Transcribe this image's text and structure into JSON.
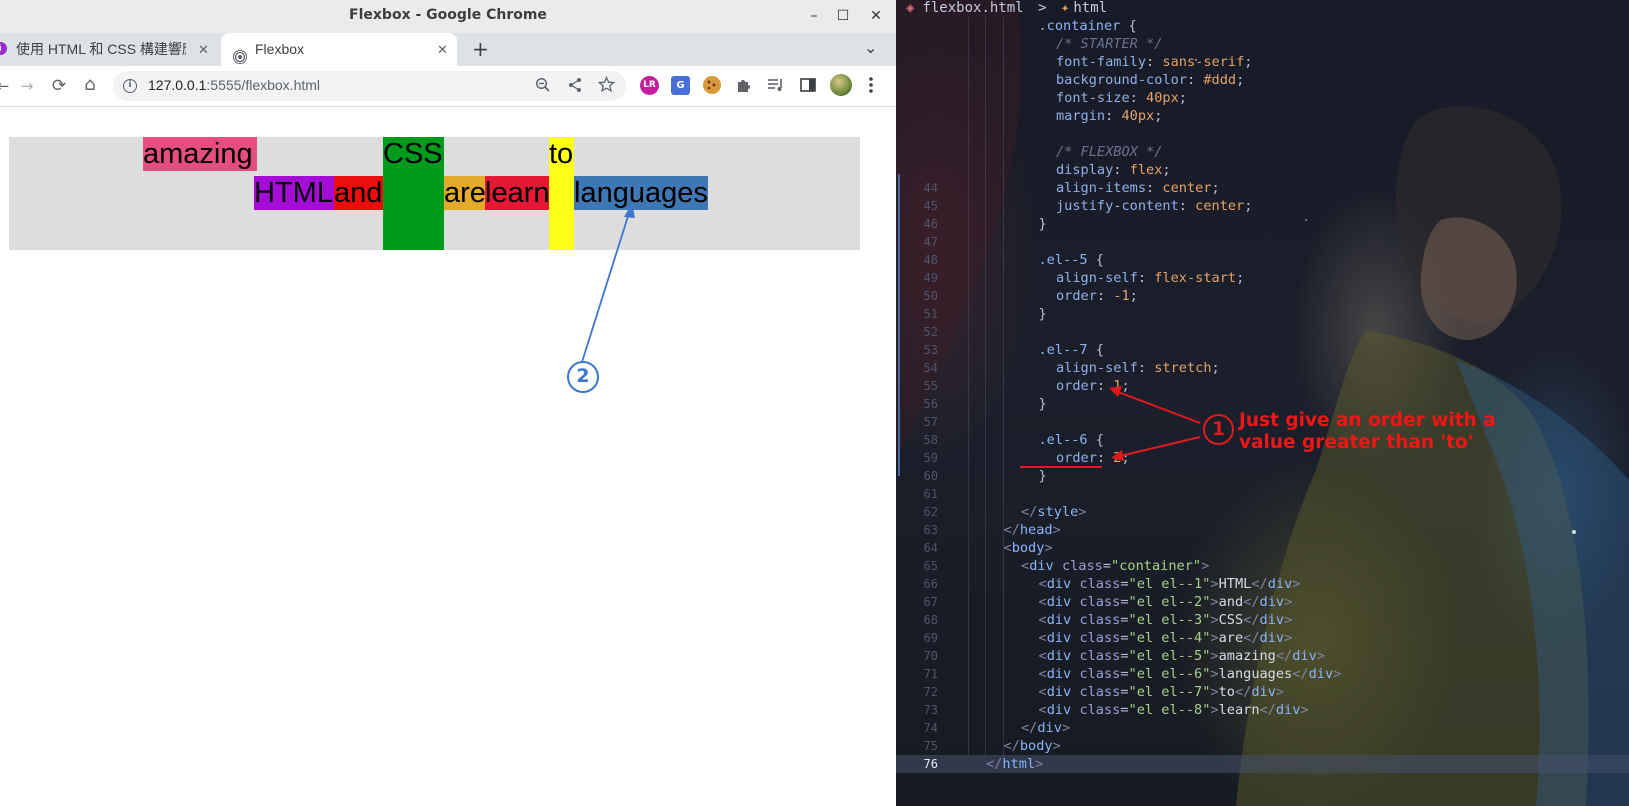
{
  "window": {
    "title": "Flexbox - Google Chrome",
    "controls": {
      "minimize": "–",
      "maximize": "☐",
      "close": "✕"
    }
  },
  "tabs": [
    {
      "label": "使用 HTML 和 CSS 構建響應式網站…",
      "favicon": "purple-circle-icon",
      "close": "✕",
      "active": false
    },
    {
      "label": "Flexbox",
      "favicon": "broadcast-icon",
      "close": "✕",
      "active": true
    }
  ],
  "tabstrip": {
    "new_tab": "+",
    "tab_search": "⌄"
  },
  "toolbar": {
    "url_host": "127.0.0.1",
    "url_rest": ":5555/flexbox.html",
    "back": "←",
    "forward": "→",
    "reload": "⟳",
    "home": "⌂"
  },
  "flex_items": {
    "amazing": "amazing",
    "css": "CSS",
    "to": "to",
    "html": "HTML",
    "and": "and",
    "are": "are",
    "learn": "learn",
    "languages": "languages"
  },
  "colors": {
    "amazing": "#e54e7f",
    "css": "#009a1d",
    "to": "#ffff1a",
    "html": "#a30dd6",
    "and": "#ec0d0d",
    "are": "#e3ab2b",
    "learn": "#e41734",
    "languages": "#3f77b5",
    "annotation_red": "#e01a1a",
    "annotation_blue": "#3a78d0"
  },
  "annotations": {
    "marker_1": "1",
    "marker_2": "2",
    "note_line1": "Just give an order with a",
    "note_line2": "value greater than 'to'"
  },
  "editor": {
    "breadcrumb_file": "flexbox.html",
    "breadcrumb_sep": ">",
    "breadcrumb_node": "html",
    "lines": [
      {
        "n": "",
        "segs": [
          [
            "t-sel",
            ".container "
          ],
          [
            "t-pun",
            "{"
          ]
        ]
      },
      {
        "n": "",
        "segs": [
          [
            "t-cmt",
            "/* STARTER */"
          ]
        ]
      },
      {
        "n": "",
        "segs": [
          [
            "t-prop",
            "font-family"
          ],
          [
            "t-pun",
            ": "
          ],
          [
            "t-val",
            "sans-serif"
          ],
          [
            "t-pun",
            ";"
          ]
        ]
      },
      {
        "n": "",
        "segs": [
          [
            "t-prop",
            "background-color"
          ],
          [
            "t-pun",
            ": "
          ],
          [
            "t-val",
            "#ddd"
          ],
          [
            "t-pun",
            ";"
          ]
        ]
      },
      {
        "n": "",
        "segs": [
          [
            "t-prop",
            "font-size"
          ],
          [
            "t-pun",
            ": "
          ],
          [
            "t-val",
            "40px"
          ],
          [
            "t-pun",
            ";"
          ]
        ]
      },
      {
        "n": "",
        "segs": [
          [
            "t-prop",
            "margin"
          ],
          [
            "t-pun",
            ": "
          ],
          [
            "t-val",
            "40px"
          ],
          [
            "t-pun",
            ";"
          ]
        ]
      },
      {
        "n": "",
        "segs": []
      },
      {
        "n": "",
        "segs": [
          [
            "t-cmt",
            "/* FLEXBOX */"
          ]
        ]
      },
      {
        "n": "",
        "segs": [
          [
            "t-prop",
            "display"
          ],
          [
            "t-pun",
            ": "
          ],
          [
            "t-val",
            "flex"
          ],
          [
            "t-pun",
            ";"
          ]
        ]
      },
      {
        "n": "44",
        "segs": [
          [
            "t-prop",
            "align-items"
          ],
          [
            "t-pun",
            ": "
          ],
          [
            "t-val",
            "center"
          ],
          [
            "t-pun",
            ";"
          ]
        ]
      },
      {
        "n": "45",
        "segs": [
          [
            "t-prop",
            "justify-content"
          ],
          [
            "t-pun",
            ": "
          ],
          [
            "t-val",
            "center"
          ],
          [
            "t-pun",
            ";"
          ]
        ]
      },
      {
        "n": "46",
        "segs": [
          [
            "t-pun",
            "}"
          ]
        ]
      },
      {
        "n": "47",
        "segs": []
      },
      {
        "n": "48",
        "segs": [
          [
            "t-sel",
            ".el--5 "
          ],
          [
            "t-pun",
            "{"
          ]
        ]
      },
      {
        "n": "49",
        "segs": [
          [
            "t-prop",
            "align-self"
          ],
          [
            "t-pun",
            ": "
          ],
          [
            "t-val",
            "flex-start"
          ],
          [
            "t-pun",
            ";"
          ]
        ]
      },
      {
        "n": "50",
        "segs": [
          [
            "t-prop",
            "order"
          ],
          [
            "t-pun",
            ": "
          ],
          [
            "t-val",
            "-1"
          ],
          [
            "t-pun",
            ";"
          ]
        ]
      },
      {
        "n": "51",
        "segs": [
          [
            "t-pun",
            "}"
          ]
        ]
      },
      {
        "n": "52",
        "segs": []
      },
      {
        "n": "53",
        "segs": [
          [
            "t-sel",
            ".el--7 "
          ],
          [
            "t-pun",
            "{"
          ]
        ]
      },
      {
        "n": "54",
        "segs": [
          [
            "t-prop",
            "align-self"
          ],
          [
            "t-pun",
            ": "
          ],
          [
            "t-val",
            "stretch"
          ],
          [
            "t-pun",
            ";"
          ]
        ]
      },
      {
        "n": "55",
        "segs": [
          [
            "t-prop",
            "order"
          ],
          [
            "t-pun",
            ": "
          ],
          [
            "t-val",
            "1"
          ],
          [
            "t-pun",
            ";"
          ]
        ]
      },
      {
        "n": "56",
        "segs": [
          [
            "t-pun",
            "}"
          ]
        ]
      },
      {
        "n": "57",
        "segs": []
      },
      {
        "n": "58",
        "segs": [
          [
            "t-sel",
            ".el--6 "
          ],
          [
            "t-pun",
            "{"
          ]
        ]
      },
      {
        "n": "59",
        "segs": [
          [
            "t-prop",
            "order"
          ],
          [
            "t-pun",
            ": "
          ],
          [
            "t-val",
            "2"
          ],
          [
            "t-pun",
            ";"
          ]
        ]
      },
      {
        "n": "60",
        "segs": [
          [
            "t-pun",
            "}"
          ]
        ]
      },
      {
        "n": "61",
        "segs": []
      },
      {
        "n": "62",
        "segs": [
          [
            "t-br",
            "</"
          ],
          [
            "t-tag",
            "style"
          ],
          [
            "t-br",
            ">"
          ]
        ]
      },
      {
        "n": "63",
        "segs": [
          [
            "t-br",
            "</"
          ],
          [
            "t-tag",
            "head"
          ],
          [
            "t-br",
            ">"
          ]
        ]
      },
      {
        "n": "64",
        "segs": [
          [
            "t-br",
            "<"
          ],
          [
            "t-tag",
            "body"
          ],
          [
            "t-br",
            ">"
          ]
        ]
      },
      {
        "n": "65",
        "segs": [
          [
            "t-br",
            "<"
          ],
          [
            "t-tag",
            "div "
          ],
          [
            "t-attr",
            "class"
          ],
          [
            "t-pun",
            "="
          ],
          [
            "t-str",
            "\"container\""
          ],
          [
            "t-br",
            ">"
          ]
        ]
      },
      {
        "n": "66",
        "segs": [
          [
            "t-br",
            "<"
          ],
          [
            "t-tag",
            "div "
          ],
          [
            "t-attr",
            "class"
          ],
          [
            "t-pun",
            "="
          ],
          [
            "t-str",
            "\"el el--1\""
          ],
          [
            "t-br",
            ">"
          ],
          [
            "t-txt",
            "HTML"
          ],
          [
            "t-br",
            "</"
          ],
          [
            "t-tag",
            "div"
          ],
          [
            "t-br",
            ">"
          ]
        ]
      },
      {
        "n": "67",
        "segs": [
          [
            "t-br",
            "<"
          ],
          [
            "t-tag",
            "div "
          ],
          [
            "t-attr",
            "class"
          ],
          [
            "t-pun",
            "="
          ],
          [
            "t-str",
            "\"el el--2\""
          ],
          [
            "t-br",
            ">"
          ],
          [
            "t-txt",
            "and"
          ],
          [
            "t-br",
            "</"
          ],
          [
            "t-tag",
            "div"
          ],
          [
            "t-br",
            ">"
          ]
        ]
      },
      {
        "n": "68",
        "segs": [
          [
            "t-br",
            "<"
          ],
          [
            "t-tag",
            "div "
          ],
          [
            "t-attr",
            "class"
          ],
          [
            "t-pun",
            "="
          ],
          [
            "t-str",
            "\"el el--3\""
          ],
          [
            "t-br",
            ">"
          ],
          [
            "t-txt",
            "CSS"
          ],
          [
            "t-br",
            "</"
          ],
          [
            "t-tag",
            "div"
          ],
          [
            "t-br",
            ">"
          ]
        ]
      },
      {
        "n": "69",
        "segs": [
          [
            "t-br",
            "<"
          ],
          [
            "t-tag",
            "div "
          ],
          [
            "t-attr",
            "class"
          ],
          [
            "t-pun",
            "="
          ],
          [
            "t-str",
            "\"el el--4\""
          ],
          [
            "t-br",
            ">"
          ],
          [
            "t-txt",
            "are"
          ],
          [
            "t-br",
            "</"
          ],
          [
            "t-tag",
            "div"
          ],
          [
            "t-br",
            ">"
          ]
        ]
      },
      {
        "n": "70",
        "segs": [
          [
            "t-br",
            "<"
          ],
          [
            "t-tag",
            "div "
          ],
          [
            "t-attr",
            "class"
          ],
          [
            "t-pun",
            "="
          ],
          [
            "t-str",
            "\"el el--5\""
          ],
          [
            "t-br",
            ">"
          ],
          [
            "t-txt",
            "amazing"
          ],
          [
            "t-br",
            "</"
          ],
          [
            "t-tag",
            "div"
          ],
          [
            "t-br",
            ">"
          ]
        ]
      },
      {
        "n": "71",
        "segs": [
          [
            "t-br",
            "<"
          ],
          [
            "t-tag",
            "div "
          ],
          [
            "t-attr",
            "class"
          ],
          [
            "t-pun",
            "="
          ],
          [
            "t-str",
            "\"el el--6\""
          ],
          [
            "t-br",
            ">"
          ],
          [
            "t-txt",
            "languages"
          ],
          [
            "t-br",
            "</"
          ],
          [
            "t-tag",
            "div"
          ],
          [
            "t-br",
            ">"
          ]
        ]
      },
      {
        "n": "72",
        "segs": [
          [
            "t-br",
            "<"
          ],
          [
            "t-tag",
            "div "
          ],
          [
            "t-attr",
            "class"
          ],
          [
            "t-pun",
            "="
          ],
          [
            "t-str",
            "\"el el--7\""
          ],
          [
            "t-br",
            ">"
          ],
          [
            "t-txt",
            "to"
          ],
          [
            "t-br",
            "</"
          ],
          [
            "t-tag",
            "div"
          ],
          [
            "t-br",
            ">"
          ]
        ]
      },
      {
        "n": "73",
        "segs": [
          [
            "t-br",
            "<"
          ],
          [
            "t-tag",
            "div "
          ],
          [
            "t-attr",
            "class"
          ],
          [
            "t-pun",
            "="
          ],
          [
            "t-str",
            "\"el el--8\""
          ],
          [
            "t-br",
            ">"
          ],
          [
            "t-txt",
            "learn"
          ],
          [
            "t-br",
            "</"
          ],
          [
            "t-tag",
            "div"
          ],
          [
            "t-br",
            ">"
          ]
        ]
      },
      {
        "n": "74",
        "segs": [
          [
            "t-br",
            "</"
          ],
          [
            "t-tag",
            "div"
          ],
          [
            "t-br",
            ">"
          ]
        ]
      },
      {
        "n": "75",
        "segs": [
          [
            "t-br",
            "</"
          ],
          [
            "t-tag",
            "body"
          ],
          [
            "t-br",
            ">"
          ]
        ]
      },
      {
        "n": "76",
        "segs": [
          [
            "t-br",
            "</"
          ],
          [
            "t-tag",
            "html"
          ],
          [
            "t-br",
            ">"
          ]
        ],
        "current": true
      }
    ]
  }
}
